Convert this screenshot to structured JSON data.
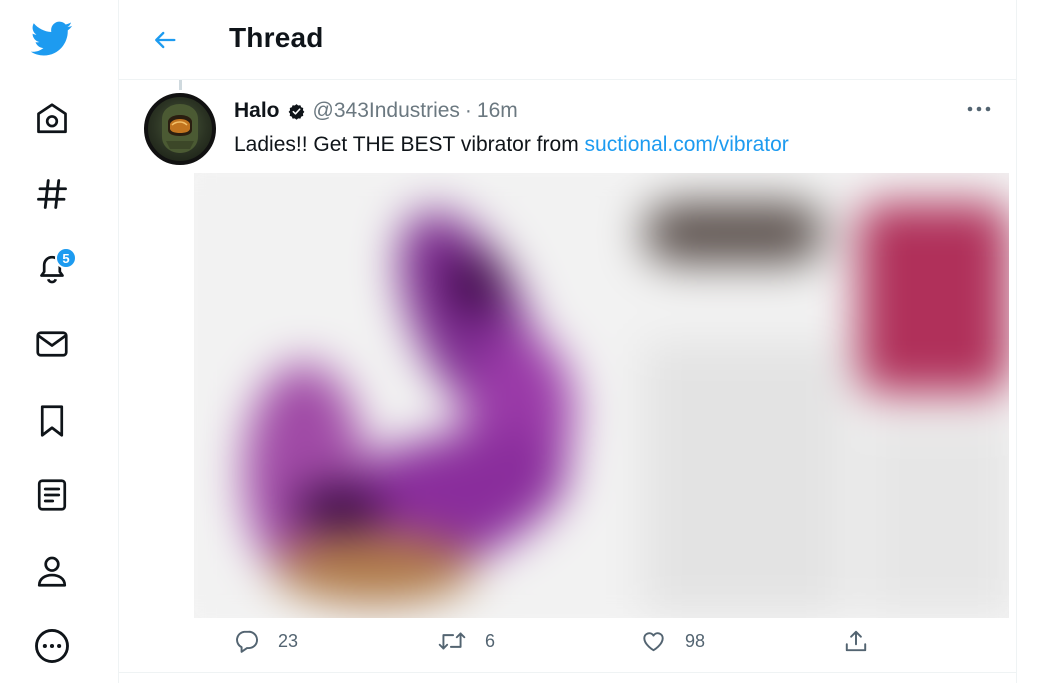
{
  "app": {
    "accent_color": "#1d9bf0",
    "nav": [
      {
        "icon": "twitter-logo-icon"
      },
      {
        "icon": "home-icon"
      },
      {
        "icon": "hashtag-icon"
      },
      {
        "icon": "bell-icon",
        "badge": "5"
      },
      {
        "icon": "mail-icon"
      },
      {
        "icon": "bookmark-icon"
      },
      {
        "icon": "list-icon"
      },
      {
        "icon": "profile-icon"
      },
      {
        "icon": "more-circle-icon"
      }
    ]
  },
  "header": {
    "title": "Thread",
    "back_icon": "arrow-left-icon"
  },
  "tweet": {
    "display_name": "Halo",
    "verified_icon": "verified-badge-icon",
    "handle": "@343Industries",
    "separator": "·",
    "time": "16m",
    "text_prefix": "Ladies!! Get THE BEST vibrator from ",
    "link_text": "suctional.com/vibrator",
    "media": "blurred product image",
    "actions": {
      "reply_count": "23",
      "retweet_count": "6",
      "like_count": "98"
    }
  }
}
